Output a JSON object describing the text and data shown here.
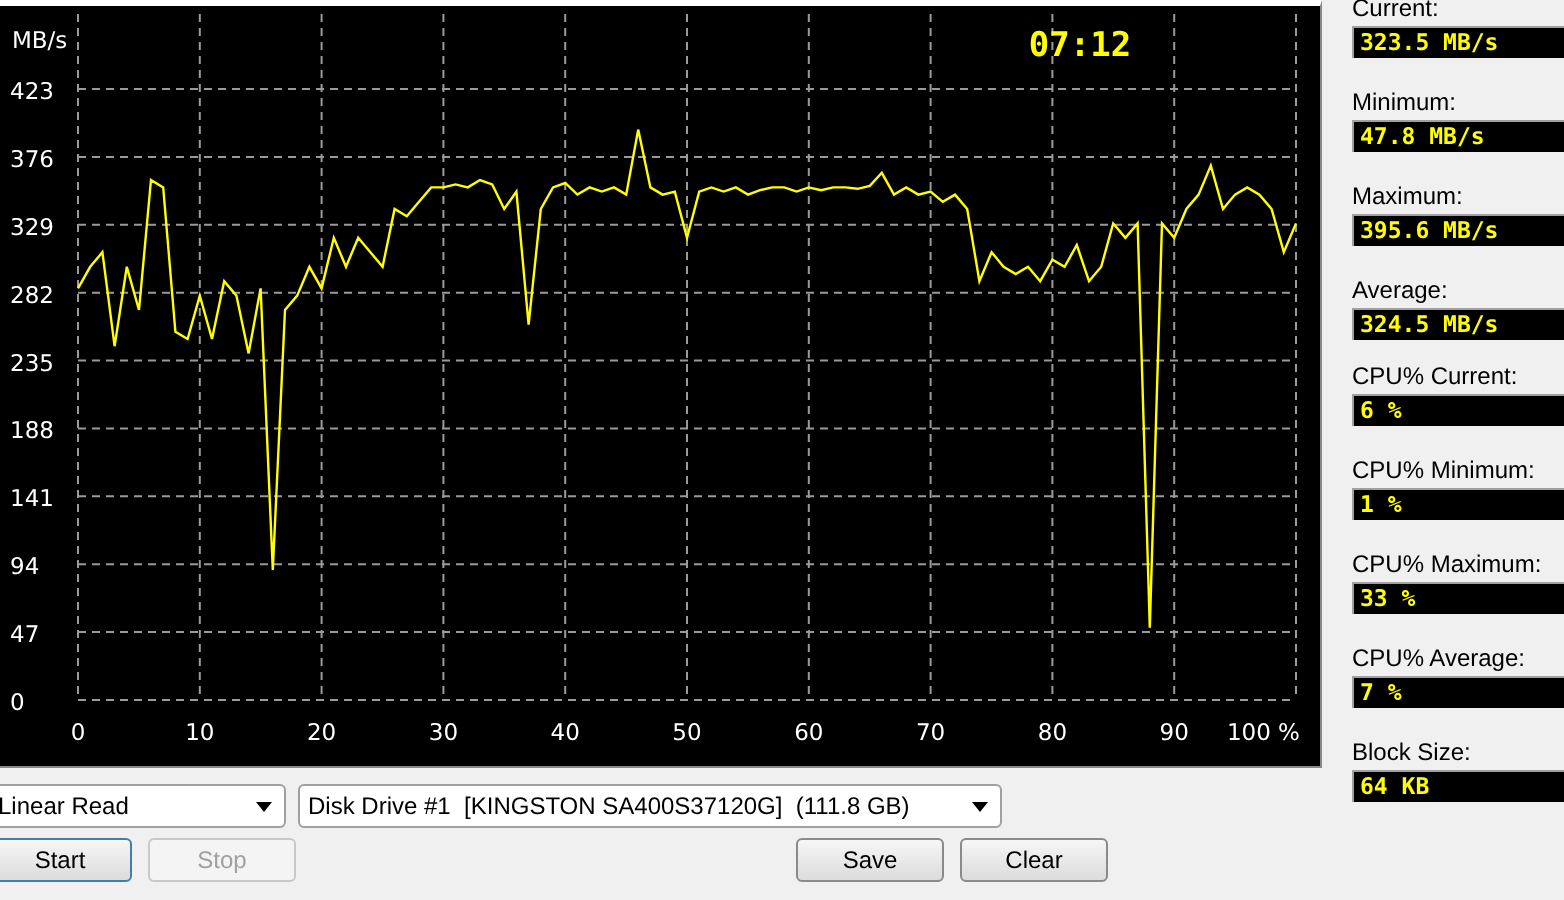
{
  "chart": {
    "time": "07:12",
    "chart_data": {
      "type": "line",
      "ylabel": "MB/s",
      "x": [
        0,
        1,
        2,
        3,
        4,
        5,
        6,
        7,
        8,
        9,
        10,
        11,
        12,
        13,
        14,
        15,
        16,
        17,
        18,
        19,
        20,
        21,
        22,
        23,
        24,
        25,
        26,
        27,
        28,
        29,
        30,
        31,
        32,
        33,
        34,
        35,
        36,
        37,
        38,
        39,
        40,
        41,
        42,
        43,
        44,
        45,
        46,
        47,
        48,
        49,
        50,
        51,
        52,
        53,
        54,
        55,
        56,
        57,
        58,
        59,
        60,
        61,
        62,
        63,
        64,
        65,
        66,
        67,
        68,
        69,
        70,
        71,
        72,
        73,
        74,
        75,
        76,
        77,
        78,
        79,
        80,
        81,
        82,
        83,
        84,
        85,
        86,
        87,
        88,
        89,
        90,
        91,
        92,
        93,
        94,
        95,
        96,
        97,
        98,
        99,
        100
      ],
      "series": [
        {
          "color": "#ffff00",
          "values": [
            285,
            300,
            310,
            245,
            300,
            270,
            360,
            355,
            255,
            250,
            280,
            250,
            290,
            280,
            240,
            285,
            90,
            270,
            280,
            300,
            285,
            320,
            300,
            320,
            310,
            300,
            340,
            335,
            345,
            355,
            355,
            357,
            355,
            360,
            357,
            340,
            352,
            260,
            340,
            355,
            358,
            350,
            355,
            352,
            355,
            350,
            395,
            355,
            350,
            352,
            320,
            352,
            355,
            352,
            355,
            350,
            353,
            355,
            355,
            352,
            355,
            353,
            355,
            355,
            354,
            356,
            365,
            350,
            355,
            350,
            352,
            345,
            350,
            340,
            290,
            310,
            300,
            295,
            300,
            290,
            305,
            300,
            315,
            290,
            300,
            330,
            320,
            330,
            50,
            330,
            320,
            340,
            350,
            370,
            340,
            350,
            355,
            350,
            340,
            310,
            330
          ]
        }
      ],
      "grid": true,
      "xlim": [
        0,
        100
      ],
      "ylim": [
        0,
        475
      ],
      "xticks": [
        0,
        10,
        20,
        30,
        40,
        50,
        60,
        70,
        80,
        90,
        {
          "value": 100,
          "label": "100 %"
        }
      ],
      "yticks": [
        0,
        47,
        94,
        141,
        188,
        235,
        282,
        329,
        376,
        423
      ]
    }
  },
  "test_select": {
    "value": "Linear Read"
  },
  "drive_select": {
    "value": "Disk Drive #1  [KINGSTON SA400S37120G]  (111.8 GB)"
  },
  "buttons": [
    {
      "label": "Start",
      "disabled": false
    },
    {
      "label": "Stop",
      "disabled": true
    },
    {
      "label": "Save",
      "disabled": false
    },
    {
      "label": "Clear",
      "disabled": false
    }
  ],
  "stat_groups": [
    {
      "items": [
        {
          "label": "Current:",
          "value": "323.5 MB/s"
        },
        {
          "label": "Minimum:",
          "value": "47.8 MB/s"
        },
        {
          "label": "Maximum:",
          "value": "395.6 MB/s"
        },
        {
          "label": "Average:",
          "value": "324.5 MB/s"
        }
      ]
    },
    {
      "items": [
        {
          "label": "CPU% Current:",
          "value": "6 %"
        },
        {
          "label": "CPU% Minimum:",
          "value": "1 %"
        },
        {
          "label": "CPU% Maximum:",
          "value": "33 %"
        },
        {
          "label": "CPU% Average:",
          "value": "7 %"
        },
        {
          "label": "Block Size:",
          "value": "64 KB"
        }
      ]
    }
  ]
}
